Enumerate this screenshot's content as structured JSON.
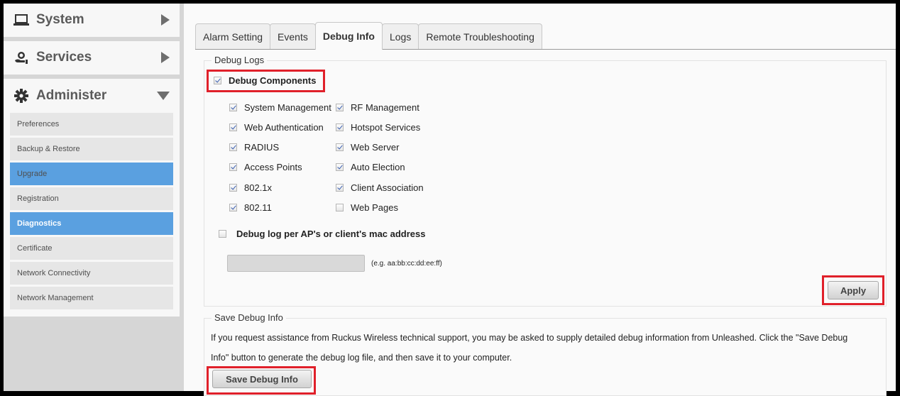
{
  "sidebar": {
    "sections": [
      {
        "label": "System",
        "icon": "laptop-icon",
        "state": "collapsed"
      },
      {
        "label": "Services",
        "icon": "services-icon",
        "state": "collapsed"
      },
      {
        "label": "Administer",
        "icon": "gear-icon",
        "state": "expanded"
      }
    ],
    "administer_items": [
      {
        "label": "Preferences",
        "state": "normal"
      },
      {
        "label": "Backup & Restore",
        "state": "normal"
      },
      {
        "label": "Upgrade",
        "state": "highlighted"
      },
      {
        "label": "Registration",
        "state": "normal"
      },
      {
        "label": "Diagnostics",
        "state": "active"
      },
      {
        "label": "Certificate",
        "state": "normal"
      },
      {
        "label": "Network Connectivity",
        "state": "normal"
      },
      {
        "label": "Network Management",
        "state": "normal"
      }
    ]
  },
  "tabs": [
    {
      "label": "Alarm Setting",
      "active": false
    },
    {
      "label": "Events",
      "active": false
    },
    {
      "label": "Debug Info",
      "active": true
    },
    {
      "label": "Logs",
      "active": false
    },
    {
      "label": "Remote Troubleshooting",
      "active": false
    }
  ],
  "debug_logs": {
    "legend": "Debug Logs",
    "debug_components": {
      "label": "Debug Components",
      "checked": true
    },
    "components_left": [
      {
        "label": "System Management",
        "checked": true
      },
      {
        "label": "Web Authentication",
        "checked": true
      },
      {
        "label": "RADIUS",
        "checked": true
      },
      {
        "label": "Access Points",
        "checked": true
      },
      {
        "label": "802.1x",
        "checked": true
      },
      {
        "label": "802.11",
        "checked": true
      }
    ],
    "components_right": [
      {
        "label": "RF Management",
        "checked": true
      },
      {
        "label": "Hotspot Services",
        "checked": true
      },
      {
        "label": "Web Server",
        "checked": true
      },
      {
        "label": "Auto Election",
        "checked": true
      },
      {
        "label": "Client Association",
        "checked": true
      },
      {
        "label": "Web Pages",
        "checked": false
      }
    ],
    "mac_debug": {
      "label": "Debug log per AP's or client's mac address",
      "checked": false
    },
    "mac_input": {
      "value": "",
      "placeholder": ""
    },
    "mac_hint": "(e.g. aa:bb:cc:dd:ee:ff)",
    "apply_label": "Apply"
  },
  "save_debug": {
    "legend": "Save Debug Info",
    "line1": "If you request assistance from Ruckus Wireless technical support, you may be asked to supply detailed debug information from Unleashed. Click the \"Save Debug",
    "line2": "Info\" button to generate the debug log file, and then save it to your computer.",
    "button_label": "Save Debug Info"
  },
  "colors": {
    "highlight": "#e0202a",
    "active_nav": "#5aa0e0"
  }
}
